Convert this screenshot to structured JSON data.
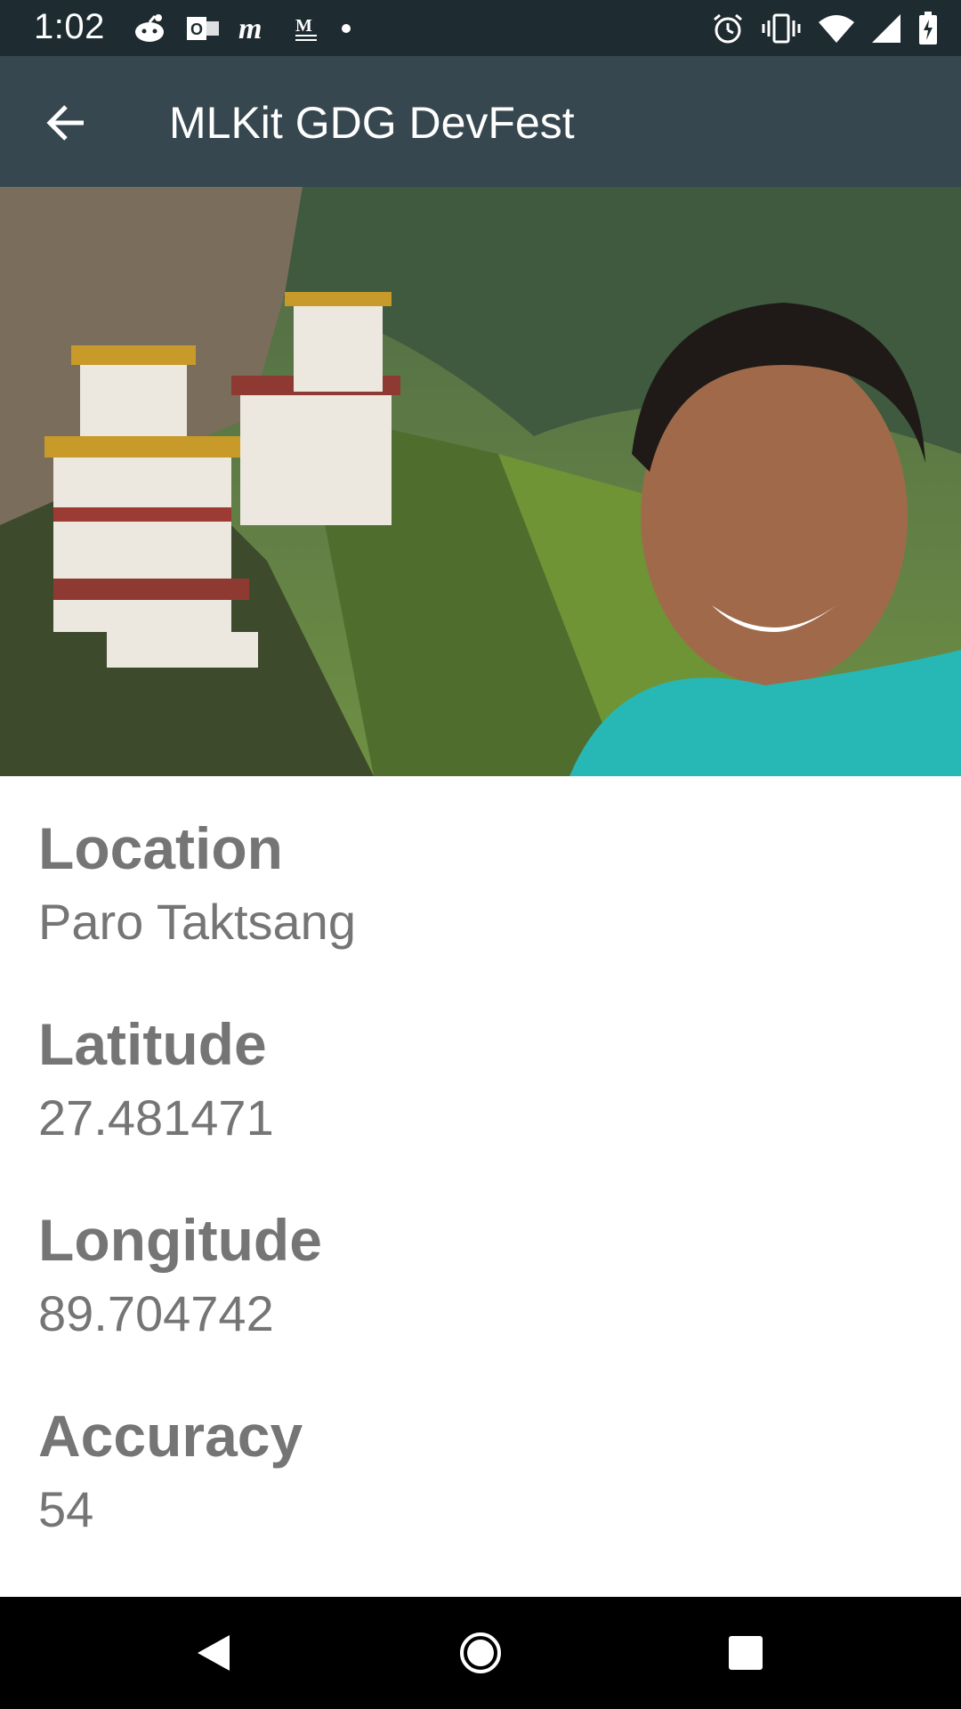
{
  "status_bar": {
    "time": "1:02",
    "left_icons": [
      "reddit-icon",
      "outlook-icon",
      "medium-icon",
      "gmail-icon",
      "dot-icon"
    ],
    "right_icons": [
      "alarm-icon",
      "vibrate-icon",
      "wifi-icon",
      "signal-icon",
      "battery-charging-icon"
    ]
  },
  "app_bar": {
    "title": "MLKit GDG DevFest",
    "back_icon": "arrow-back-icon"
  },
  "photo": {
    "description_icon": "landmark-photo"
  },
  "details": [
    {
      "label": "Location",
      "value": "Paro Taktsang"
    },
    {
      "label": "Latitude",
      "value": "27.481471"
    },
    {
      "label": "Longitude",
      "value": "89.704742"
    },
    {
      "label": "Accuracy",
      "value": "54"
    }
  ],
  "nav_bar": {
    "back_icon": "nav-back-icon",
    "home_icon": "nav-home-icon",
    "recents_icon": "nav-recents-icon"
  },
  "colors": {
    "status_bar": "#1e2b31",
    "app_bar": "#37474f",
    "text_gray": "#757575",
    "nav_bar": "#000000"
  }
}
